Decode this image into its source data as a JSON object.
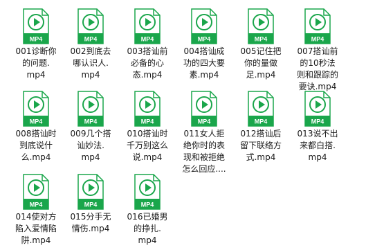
{
  "icon_badge": "MP4",
  "accent_color": "#1aa64b",
  "icon_name": "video-file-icon",
  "files": [
    {
      "lines": [
        "001诊断你",
        "的问题.",
        "mp4"
      ]
    },
    {
      "lines": [
        "002到底去",
        "哪认识人.",
        "mp4"
      ]
    },
    {
      "lines": [
        "003搭讪前",
        "必备的心",
        "态.mp4"
      ]
    },
    {
      "lines": [
        "004搭讪成",
        "功的四大要",
        "素.mp4"
      ]
    },
    {
      "lines": [
        "005记住把",
        "你的量做",
        "足.mp4"
      ]
    },
    {
      "lines": [
        "007搭讪前",
        "的10秒法",
        "则和跟踪的",
        "要诀.mp4"
      ]
    },
    {
      "lines": [
        "008搭讪时",
        "到底说什",
        "么.mp4"
      ]
    },
    {
      "lines": [
        "009几个搭",
        "讪妙法.",
        "mp4"
      ]
    },
    {
      "lines": [
        "010搭讪时",
        "千万别这么",
        "说.mp4"
      ]
    },
    {
      "lines": [
        "011女人拒",
        "绝你时的表",
        "现和被拒绝",
        "怎么回应...."
      ]
    },
    {
      "lines": [
        "012搭讪后",
        "留下联络方",
        "式.mp4"
      ]
    },
    {
      "lines": [
        "013说不出",
        "来都白搭.",
        "mp4"
      ]
    },
    {
      "lines": [
        "014使对方",
        "陷入爱情陷",
        "阱.mp4"
      ]
    },
    {
      "lines": [
        "015分手无",
        "情伤.mp4"
      ]
    },
    {
      "lines": [
        "016已婚男",
        "的挣扎.",
        "mp4"
      ]
    }
  ]
}
